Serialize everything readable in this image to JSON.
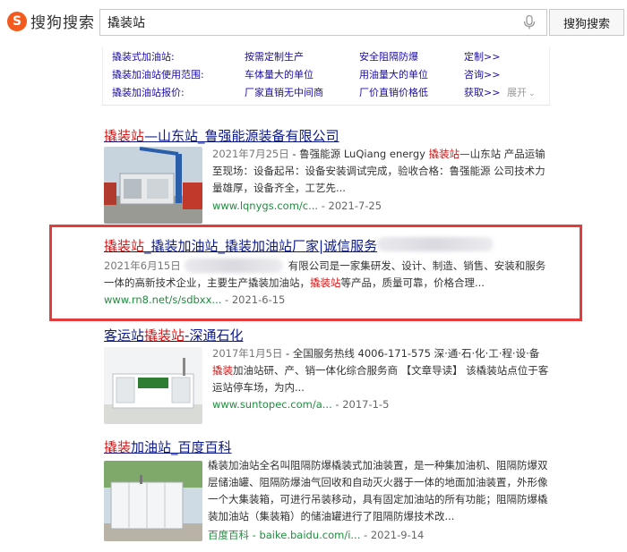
{
  "header": {
    "logo_text": "搜狗搜索",
    "search_value": "撬装站",
    "search_button": "搜狗搜索"
  },
  "related": {
    "rows": [
      [
        "撬装式加油站:",
        "按需定制生产",
        "安全阻隔防爆",
        "定制>>"
      ],
      [
        "撬装加油站使用范围:",
        "车体量大的单位",
        "用油量大的单位",
        "咨询>>"
      ],
      [
        "撬装加油站报价:",
        "厂家直销无中间商",
        "厂价直销价格低",
        "获取>>"
      ]
    ],
    "expand_label": "展开"
  },
  "results": [
    {
      "title_hl": "撬装站",
      "title_rest": "—山东站_鲁强能源装备有限公司",
      "date": "2021年7月25日",
      "snippet_a": " - 鲁强能源 LuQiang energy ",
      "snippet_hl": "撬装站",
      "snippet_b": "—山东站 产品运输至现场：设备起吊：设备安装调试完成，验收合格：鲁强能源 公司技术力量雄厚，设备齐全，工艺先...",
      "url": "www.lqnygs.com/c...",
      "url_date": " - 2021-7-25"
    },
    {
      "title_a_hl": "撬装站",
      "title_a": "_撬装加油站_撬装加油站厂家|诚信服务",
      "date": "2021年6月15日",
      "snippet_a": "有限公司是一家集研发、设计、制造、销售、安装和服务一体的高新技术企业，主要生产撬装加油站，",
      "snippet_hl": "撬装站",
      "snippet_b": "等产品，质量可靠，价格合理...",
      "url": "www.rn8.net/s/sdbxx...",
      "url_date": " - 2021-6-15"
    },
    {
      "title_a": "客运站",
      "title_hl": "撬装站",
      "title_b": "-深通石化",
      "date": "2017年1月5日",
      "snippet_a": " - 全国服务热线 4006-171-575 深·通·石·化·工·程·设·备",
      "snippet_hl": "撬装",
      "snippet_b": "加油站研、产、销一体化综合服务商 【文章导读】 该橇装站点位于客运站停车场，为内...",
      "url": "www.suntopec.com/a...",
      "url_date": " - 2017-1-5"
    },
    {
      "title_hl": "撬装",
      "title_rest": "加油站_百度百科",
      "snippet": "橇装加油站全名叫阻隔防爆橇装式加油装置，是一种集加油机、阻隔防爆双层储油罐、阻隔防爆油气回收和自动灭火器于一体的地面加油装置，外形像一个大集装箱，可进行吊装移动，具有固定加油站的所有功能；阻隔防爆橇装加油站（集装箱）的储油罐进行了阻隔防爆技术改...",
      "source": "百度百科",
      "url": " - baike.baidu.com/i...",
      "url_date": " - 2021-9-14"
    }
  ],
  "colors": {
    "link": "#0d1a8b",
    "highlight": "#d01616",
    "url": "#1f8e3e",
    "box": "#e33c3c"
  }
}
